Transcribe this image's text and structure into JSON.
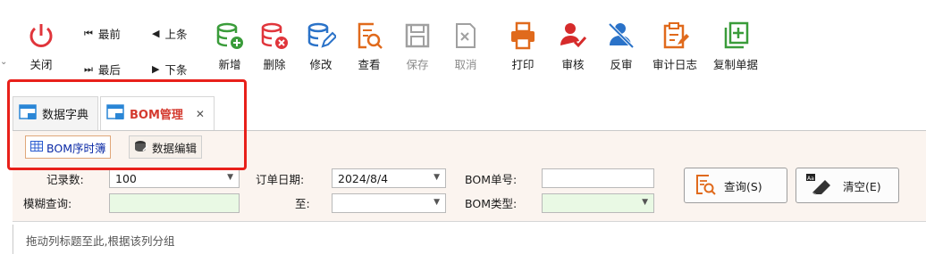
{
  "toolbar": {
    "close_label": "关闭",
    "nav": {
      "first": "最前",
      "prev": "上条",
      "last": "最后",
      "next": "下条"
    },
    "buttons": [
      {
        "label": "新增",
        "icon": "database-add-icon",
        "color": "#3a9c3a"
      },
      {
        "label": "删除",
        "icon": "database-delete-icon",
        "color": "#e0353b"
      },
      {
        "label": "修改",
        "icon": "database-edit-icon",
        "color": "#2a72c8"
      },
      {
        "label": "查看",
        "icon": "view-document-icon",
        "color": "#e06a1c"
      },
      {
        "label": "保存",
        "icon": "save-icon",
        "color": "#a0a0a0"
      },
      {
        "label": "取消",
        "icon": "cancel-icon",
        "color": "#a0a0a0"
      },
      {
        "label": "打印",
        "icon": "printer-icon",
        "color": "#e06a1c"
      },
      {
        "label": "审核",
        "icon": "approve-user-icon",
        "color": "#d62b2b"
      },
      {
        "label": "反审",
        "icon": "unapprove-user-icon",
        "color": "#2a72c8"
      },
      {
        "label": "审计日志",
        "icon": "audit-log-icon",
        "color": "#e06a1c"
      },
      {
        "label": "复制单据",
        "icon": "copy-document-icon",
        "color": "#3a9c3a"
      }
    ]
  },
  "doc_tabs": [
    {
      "label": "数据字典",
      "active": false
    },
    {
      "label": "BOM管理",
      "active": true
    }
  ],
  "sub_tabs": [
    {
      "label": "BOM序时簿",
      "active": true
    },
    {
      "label": "数据编辑",
      "active": false
    }
  ],
  "query": {
    "record_count_label": "记录数:",
    "record_count_value": "100",
    "fuzzy_label": "模糊查询:",
    "fuzzy_value": "",
    "order_date_label": "订单日期:",
    "order_date_value": "2024/8/4",
    "to_label": "至:",
    "to_value": "",
    "bom_no_label": "BOM单号:",
    "bom_no_value": "",
    "bom_type_label": "BOM类型:",
    "bom_type_value": "",
    "search_button": "查询(S)",
    "clear_button": "清空(E)"
  },
  "group_hint": "拖动列标题至此,根据该列分组"
}
